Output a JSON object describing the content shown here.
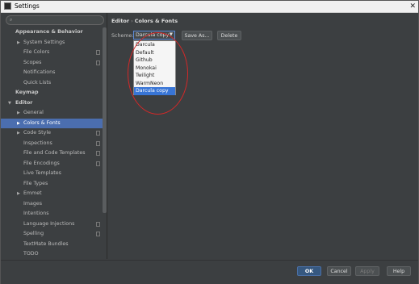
{
  "window": {
    "title": "Settings",
    "close_glyph": "✕"
  },
  "search": {
    "placeholder": "",
    "value": "",
    "icon": "search-icon"
  },
  "sidebar": {
    "items": [
      {
        "label": "Appearance & Behavior",
        "level": 0,
        "bold": true,
        "arrow": "",
        "copy_icon": false,
        "selected": false
      },
      {
        "label": "System Settings",
        "level": 1,
        "bold": false,
        "arrow": "▶",
        "copy_icon": false,
        "selected": false
      },
      {
        "label": "File Colors",
        "level": 1,
        "bold": false,
        "arrow": "",
        "copy_icon": true,
        "selected": false
      },
      {
        "label": "Scopes",
        "level": 1,
        "bold": false,
        "arrow": "",
        "copy_icon": true,
        "selected": false
      },
      {
        "label": "Notifications",
        "level": 1,
        "bold": false,
        "arrow": "",
        "copy_icon": false,
        "selected": false
      },
      {
        "label": "Quick Lists",
        "level": 1,
        "bold": false,
        "arrow": "",
        "copy_icon": false,
        "selected": false
      },
      {
        "label": "Keymap",
        "level": 0,
        "bold": true,
        "arrow": "",
        "copy_icon": false,
        "selected": false
      },
      {
        "label": "Editor",
        "level": 0,
        "bold": true,
        "arrow": "▼",
        "copy_icon": false,
        "selected": false
      },
      {
        "label": "General",
        "level": 1,
        "bold": false,
        "arrow": "▶",
        "copy_icon": false,
        "selected": false
      },
      {
        "label": "Colors & Fonts",
        "level": 1,
        "bold": false,
        "arrow": "▶",
        "copy_icon": false,
        "selected": true
      },
      {
        "label": "Code Style",
        "level": 1,
        "bold": false,
        "arrow": "▶",
        "copy_icon": true,
        "selected": false
      },
      {
        "label": "Inspections",
        "level": 1,
        "bold": false,
        "arrow": "",
        "copy_icon": true,
        "selected": false
      },
      {
        "label": "File and Code Templates",
        "level": 1,
        "bold": false,
        "arrow": "",
        "copy_icon": true,
        "selected": false
      },
      {
        "label": "File Encodings",
        "level": 1,
        "bold": false,
        "arrow": "",
        "copy_icon": true,
        "selected": false
      },
      {
        "label": "Live Templates",
        "level": 1,
        "bold": false,
        "arrow": "",
        "copy_icon": false,
        "selected": false
      },
      {
        "label": "File Types",
        "level": 1,
        "bold": false,
        "arrow": "",
        "copy_icon": false,
        "selected": false
      },
      {
        "label": "Emmet",
        "level": 1,
        "bold": false,
        "arrow": "▶",
        "copy_icon": false,
        "selected": false
      },
      {
        "label": "Images",
        "level": 1,
        "bold": false,
        "arrow": "",
        "copy_icon": false,
        "selected": false
      },
      {
        "label": "Intentions",
        "level": 1,
        "bold": false,
        "arrow": "",
        "copy_icon": false,
        "selected": false
      },
      {
        "label": "Language Injections",
        "level": 1,
        "bold": false,
        "arrow": "",
        "copy_icon": true,
        "selected": false
      },
      {
        "label": "Spelling",
        "level": 1,
        "bold": false,
        "arrow": "",
        "copy_icon": true,
        "selected": false
      },
      {
        "label": "TextMate Bundles",
        "level": 1,
        "bold": false,
        "arrow": "",
        "copy_icon": false,
        "selected": false
      },
      {
        "label": "TODO",
        "level": 1,
        "bold": false,
        "arrow": "",
        "copy_icon": false,
        "selected": false
      }
    ]
  },
  "content": {
    "breadcrumb": [
      "Editor",
      "Colors & Fonts"
    ],
    "breadcrumb_sep": "›",
    "scheme_label": "Scheme:",
    "scheme_value": "Darcula copy",
    "caret": "▼",
    "save_as_label": "Save As...",
    "delete_label": "Delete",
    "scheme_options": [
      "Darcula",
      "Default",
      "Github",
      "Monokai",
      "Twilight",
      "WarmNeon",
      "Darcula copy"
    ],
    "selected_option": "Darcula copy"
  },
  "footer": {
    "ok_label": "OK",
    "cancel_label": "Cancel",
    "apply_label": "Apply",
    "help_label": "Help"
  },
  "colors": {
    "background": "#3c3f41",
    "selection": "#4b6eaf",
    "dropdown_selection": "#3875d6",
    "annotation": "#d42828"
  }
}
